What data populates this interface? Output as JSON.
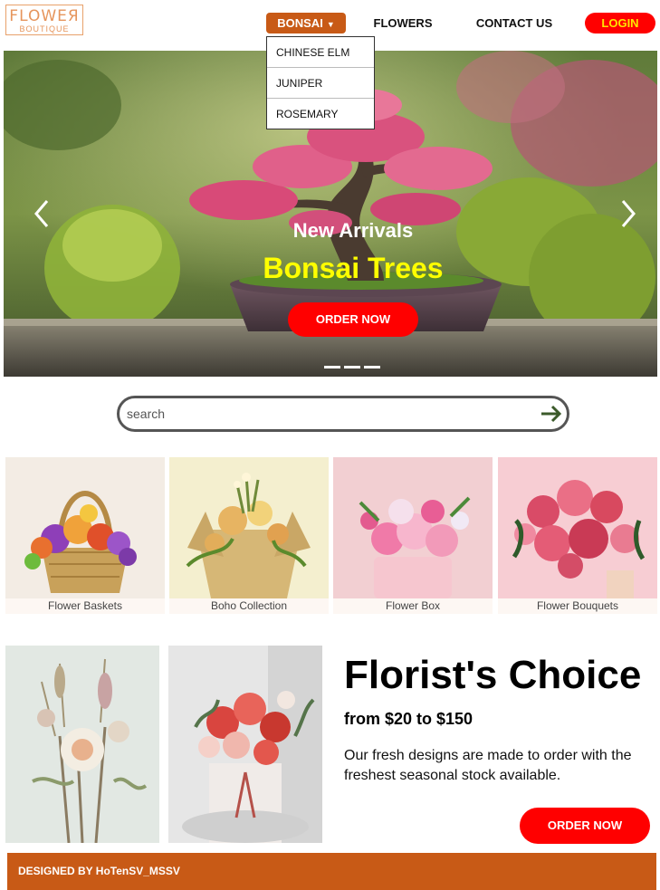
{
  "logo": {
    "line1": "FLOWEЯ",
    "line2": "BOUTIQUE"
  },
  "nav": {
    "bonsai": "BONSAI",
    "flowers": "FLOWERS",
    "contact": "CONTACT US",
    "login": "LOGIN",
    "dropdown": [
      "CHINESE ELM",
      "JUNIPER",
      "ROSEMARY"
    ]
  },
  "hero": {
    "subtitle": "New Arrivals",
    "title": "Bonsai Trees",
    "order": "ORDER NOW",
    "slides": 3
  },
  "search": {
    "placeholder": "search"
  },
  "categories": [
    "Flower Baskets",
    "Boho Collection",
    "Flower Box",
    "Flower Bouquets"
  ],
  "florist": {
    "title": "Florist's Choice",
    "price": "from $20 to $150",
    "description": "Our fresh designs are made to order with the freshest seasonal stock available.",
    "order": "ORDER NOW"
  },
  "footer": {
    "text": "DESIGNED BY HoTenSV_MSSV"
  },
  "colors": {
    "accent": "#c85a16",
    "cta": "#ff0000",
    "login_text": "#ffe400",
    "hero_title": "#ffff00"
  }
}
